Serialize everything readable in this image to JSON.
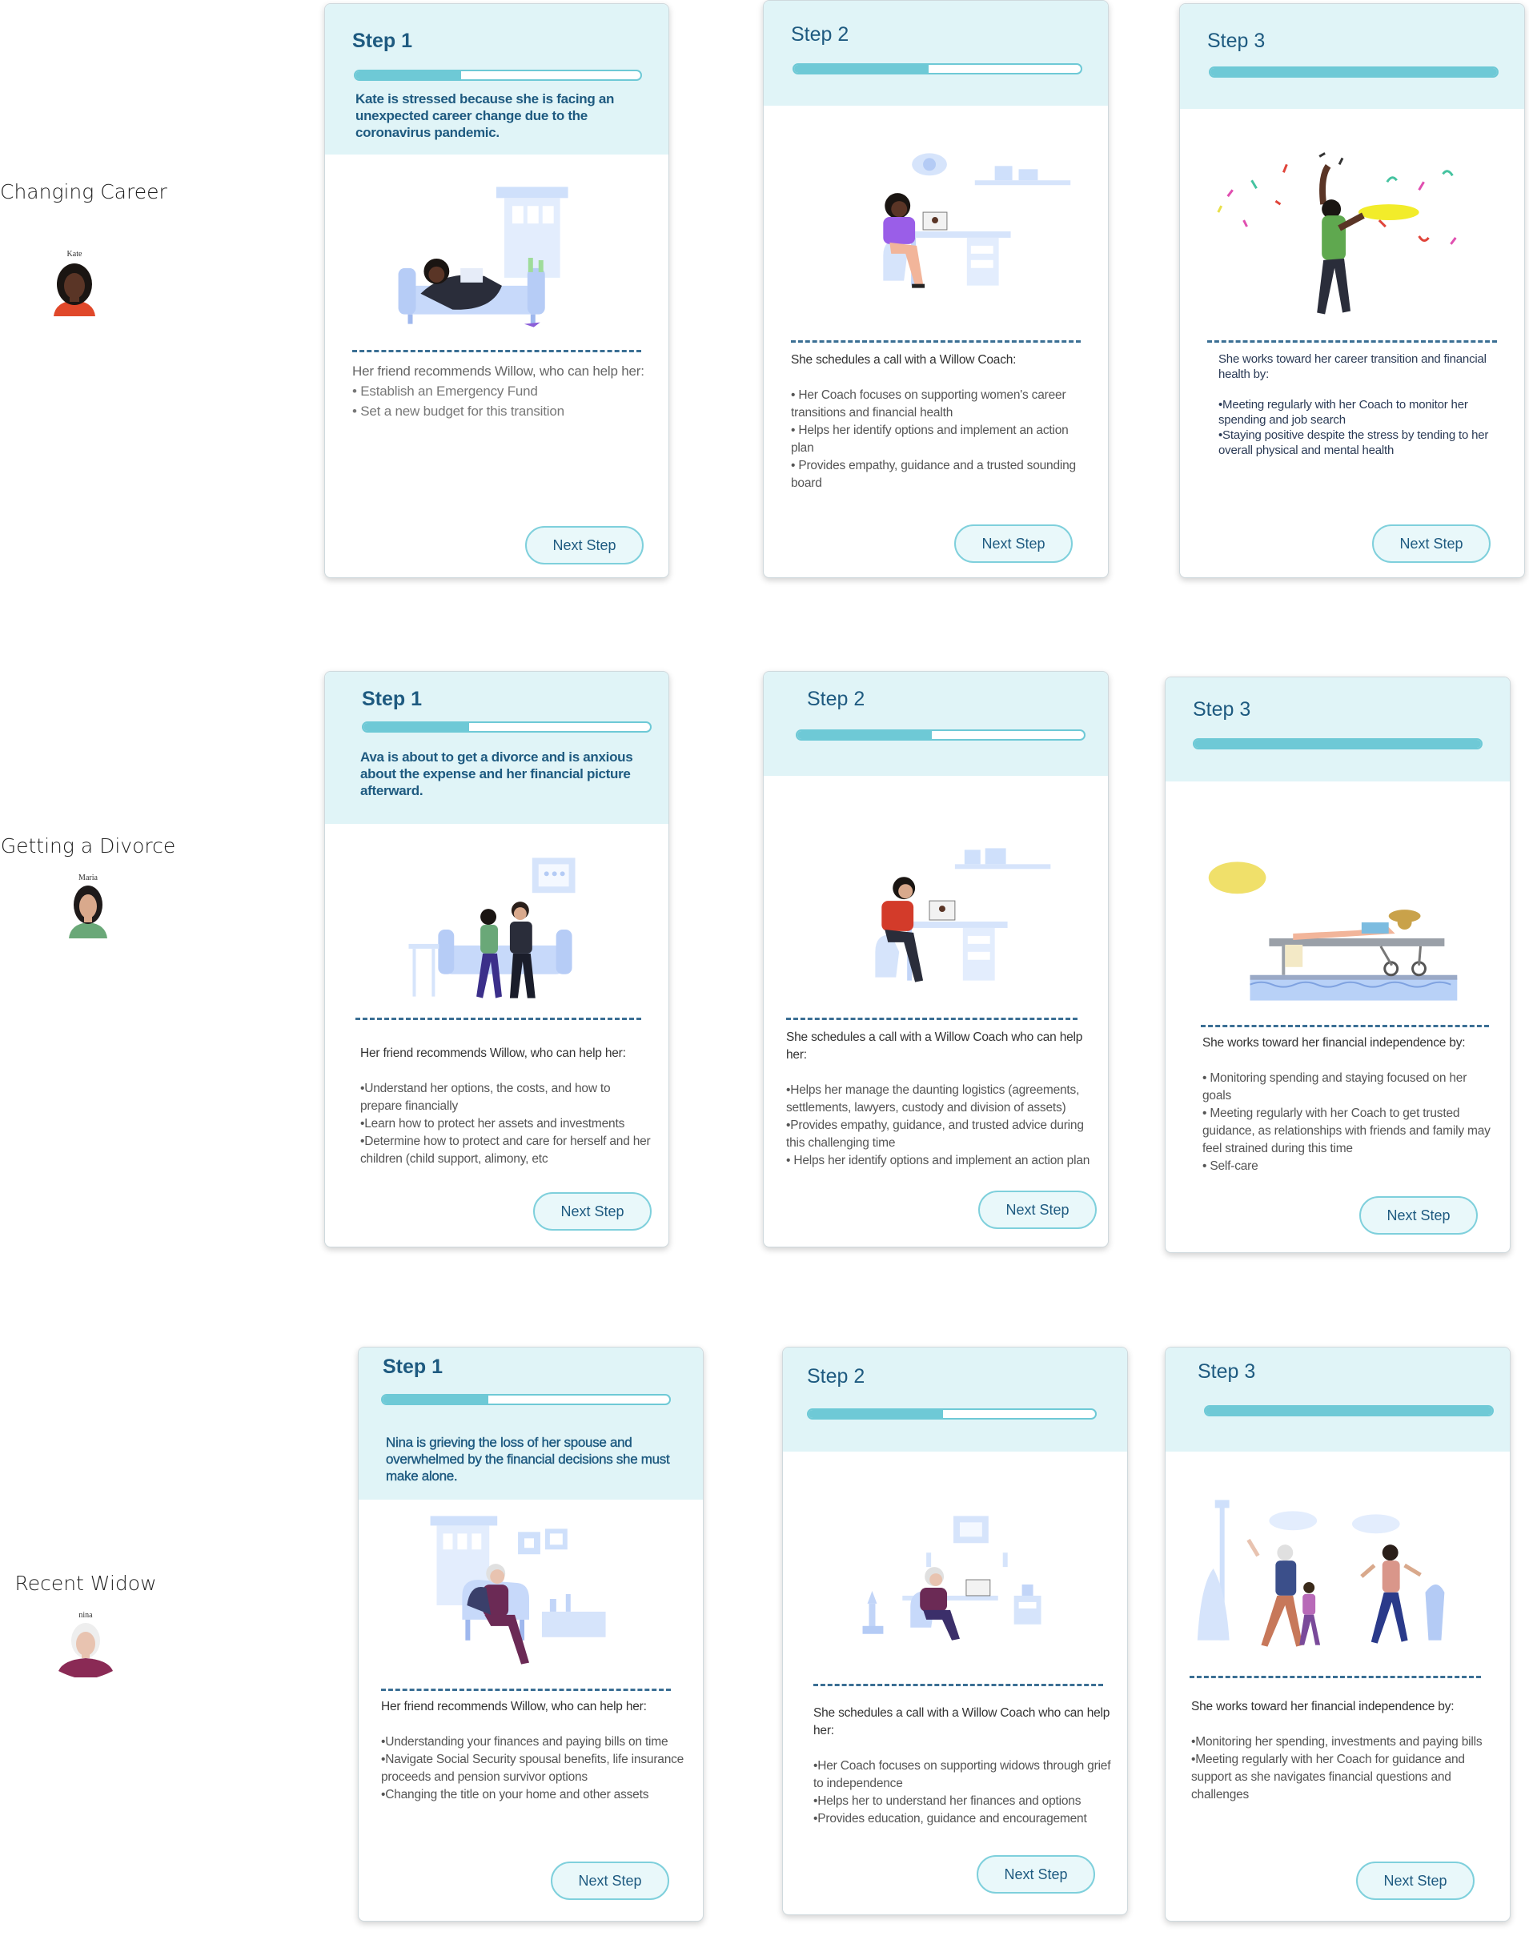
{
  "personas": [
    {
      "title": "Changing Career",
      "name": "Kate",
      "steps": [
        {
          "label": "Step 1",
          "progress": 0.37,
          "description": "Kate is stressed because she is facing an unexpected career change due to the coronavirus pandemic.",
          "intro": "Her friend recommends Willow, who can help her:",
          "items": [
            "• Establish an Emergency Fund",
            "• Set a new budget for this transition"
          ],
          "button": "Next Step"
        },
        {
          "label": "Step 2",
          "progress": 0.47,
          "description": "",
          "intro": "She schedules a call with a Willow Coach:",
          "items": [
            "• Her Coach focuses on supporting women's career transitions and financial health",
            "• Helps her identify options and implement an action plan",
            "• Provides empathy, guidance and a trusted sounding board"
          ],
          "button": "Next Step"
        },
        {
          "label": "Step 3",
          "progress": 1.0,
          "description": "",
          "intro": "She works toward her career transition and financial health by:",
          "items": [
            "•Meeting regularly with her Coach to monitor her spending and job search",
            "•Staying positive despite the stress by tending to her overall physical and mental health"
          ],
          "button": "Next Step"
        }
      ]
    },
    {
      "title": "Getting a Divorce",
      "name": "Maria",
      "steps": [
        {
          "label": "Step 1",
          "progress": 0.37,
          "description": "Ava is about to get a divorce and is anxious about the expense and her financial picture afterward.",
          "intro": "Her friend recommends Willow, who can help her:",
          "items": [
            "•Understand her options, the costs, and how to prepare financially",
            "•Learn how to protect her assets and investments",
            "•Determine how to protect and care for herself and her children (child support, alimony, etc"
          ],
          "button": "Next Step"
        },
        {
          "label": "Step 2",
          "progress": 0.47,
          "description": "",
          "intro": "She schedules a call with a Willow Coach who can help her:",
          "items": [
            "•Helps her manage the daunting logistics (agreements, settlements, lawyers, custody and division of assets)",
            "•Provides empathy, guidance, and trusted advice during this challenging time",
            "• Helps her identify options and implement an action plan"
          ],
          "button": "Next Step"
        },
        {
          "label": "Step 3",
          "progress": 1.0,
          "description": "",
          "intro": "She works toward her financial independence by:",
          "items": [
            "• Monitoring spending and staying focused on her goals",
            "• Meeting regularly with her Coach to get trusted guidance, as relationships with friends and family may feel strained during this time",
            "• Self-care"
          ],
          "button": "Next Step"
        }
      ]
    },
    {
      "title": "Recent Widow",
      "name": "nina",
      "steps": [
        {
          "label": "Step 1",
          "progress": 0.37,
          "description": "Nina is grieving the loss of her spouse and overwhelmed by the financial decisions she must make alone.",
          "intro": "Her friend recommends Willow, who can help her:",
          "items": [
            "•Understanding your finances and paying bills on time",
            "•Navigate Social Security spousal benefits, life insurance proceeds and pension survivor options",
            "•Changing the title on your home and other assets"
          ],
          "button": "Next Step"
        },
        {
          "label": "Step 2",
          "progress": 0.47,
          "description": "",
          "intro": "She schedules a call with a Willow Coach who can help her:",
          "items": [
            "•Her Coach focuses on supporting widows through grief to independence",
            "•Helps her to understand her finances and options",
            "•Provides education, guidance and encouragement"
          ],
          "button": "Next Step"
        },
        {
          "label": "Step 3",
          "progress": 1.0,
          "description": "",
          "intro": "She works toward her financial independence by:",
          "items": [
            "•Monitoring her spending, investments and paying bills",
            "•Meeting regularly with her Coach for guidance and support as she navigates financial questions and challenges"
          ],
          "button": "Next Step"
        }
      ]
    }
  ],
  "colors": {
    "header_bg": "#e0f4f7",
    "accent": "#6ec9d6",
    "title_text": "#1e5a80",
    "dash": "#3b6f94"
  }
}
